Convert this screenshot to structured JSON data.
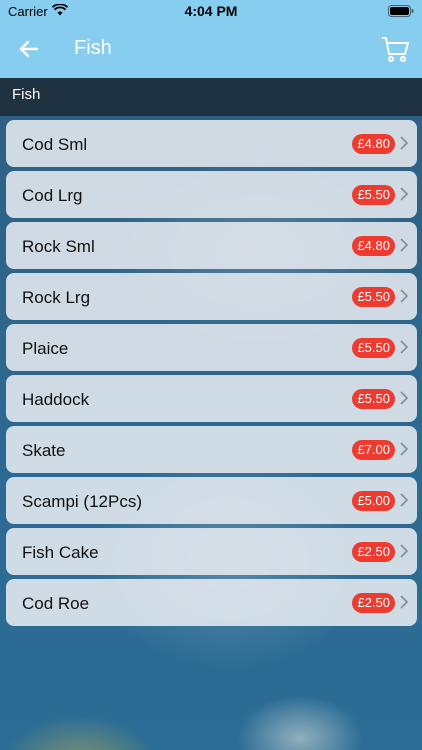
{
  "status_bar": {
    "carrier": "Carrier",
    "time": "4:04 PM"
  },
  "nav": {
    "title": "Fish",
    "back_icon": "back-arrow-icon",
    "cart_icon": "cart-icon"
  },
  "section": {
    "title": "Fish"
  },
  "items": [
    {
      "name": "Cod Sml",
      "price": "£4.80"
    },
    {
      "name": "Cod Lrg",
      "price": "£5.50"
    },
    {
      "name": "Rock Sml",
      "price": "£4.80"
    },
    {
      "name": "Rock Lrg",
      "price": "£5.50"
    },
    {
      "name": "Plaice",
      "price": "£5.50"
    },
    {
      "name": "Haddock",
      "price": "£5.50"
    },
    {
      "name": "Skate",
      "price": "£7.00"
    },
    {
      "name": "Scampi (12Pcs)",
      "price": "£5.00"
    },
    {
      "name": "Fish Cake",
      "price": "£2.50"
    },
    {
      "name": "Cod Roe",
      "price": "£2.50"
    }
  ],
  "colors": {
    "nav_bg": "#86cdf0",
    "price_badge": "#ee3a2f",
    "header_bg": "#1c2a37"
  }
}
